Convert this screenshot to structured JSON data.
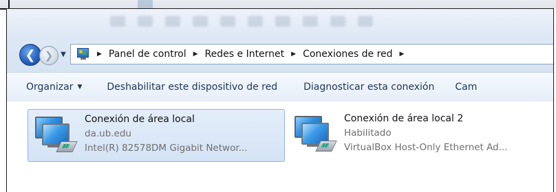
{
  "breadcrumb": {
    "items": [
      "Panel de control",
      "Redes e Internet",
      "Conexiones de red"
    ]
  },
  "toolbar": {
    "organize_label": "Organizar",
    "disable_label": "Deshabilitar este dispositivo de red",
    "diagnose_label": "Diagnosticar esta conexión",
    "cut_label": "Cam"
  },
  "connections": [
    {
      "name": "Conexión de área local",
      "status": "da.ub.edu",
      "device": "Intel(R) 82578DM Gigabit Networ...",
      "selected": true,
      "icon": "network-adapter-icon"
    },
    {
      "name": "Conexión de área local 2",
      "status": "Habilitado",
      "device": "VirtualBox Host-Only Ethernet Ad...",
      "selected": false,
      "icon": "network-adapter-icon"
    }
  ],
  "colors": {
    "selection_bg": "#d4e3f5",
    "selection_border": "#8fb3de",
    "command_text": "#1e3556"
  }
}
